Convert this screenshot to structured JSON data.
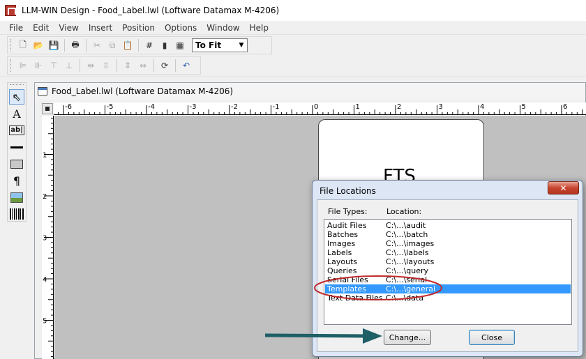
{
  "window": {
    "title": "LLM-WIN Design - Food_Label.lwl (Loftware Datamax M-4206)"
  },
  "menu": [
    "File",
    "Edit",
    "View",
    "Insert",
    "Position",
    "Options",
    "Window",
    "Help"
  ],
  "toolbar": {
    "zoom_value": "To Fit"
  },
  "document": {
    "title": "Food_Label.lwl (Loftware Datamax M-4206)",
    "label_text": "FTS",
    "hruler_ticks": [
      "-6",
      "-5",
      "-4",
      "-3",
      "-2",
      "-1",
      "0",
      "1",
      "2",
      "3",
      "4",
      "5",
      "6"
    ],
    "vruler_ticks": [
      "1",
      "2",
      "3",
      "4",
      "5"
    ]
  },
  "dialog": {
    "title": "File Locations",
    "col_types": "File Types:",
    "col_location": "Location:",
    "rows": [
      {
        "type": "Audit Files",
        "location": "C:\\...\\audit"
      },
      {
        "type": "Batches",
        "location": "C:\\...\\batch"
      },
      {
        "type": "Images",
        "location": "C:\\...\\images"
      },
      {
        "type": "Labels",
        "location": "C:\\...\\labels"
      },
      {
        "type": "Layouts",
        "location": "C:\\...\\layouts"
      },
      {
        "type": "Queries",
        "location": "C:\\...\\query"
      },
      {
        "type": "Serial Files",
        "location": "C:\\...\\serial"
      },
      {
        "type": "Templates",
        "location": "C:\\...\\general"
      },
      {
        "type": "Text Data Files",
        "location": "C:\\...\\data"
      }
    ],
    "selected_index": 7,
    "change_label": "Change...",
    "close_label": "Close"
  },
  "colors": {
    "selection": "#3399ff",
    "annotation_ellipse": "#c0282a",
    "annotation_arrow": "#1f5f66"
  }
}
